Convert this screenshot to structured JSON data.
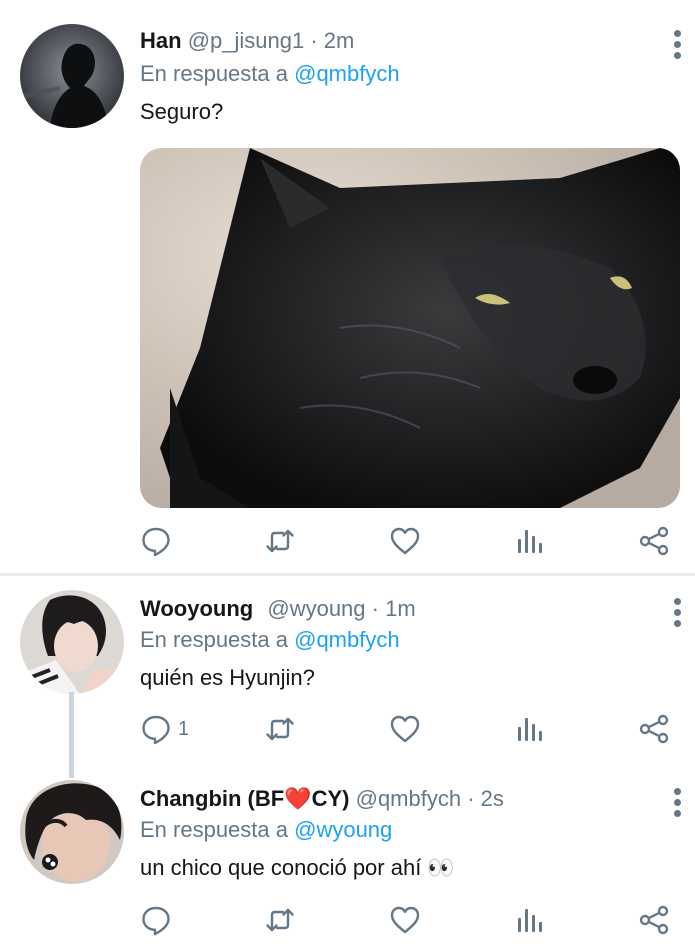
{
  "tweets": [
    {
      "name": "Han",
      "handle": "@p_jisung1",
      "time": "· 2m",
      "reply_prefix": "En respuesta a",
      "reply_to": "@qmbfych",
      "text": "Seguro?",
      "media": "black-cat-photo",
      "reply_count": "",
      "icons": [
        "reply-icon",
        "retweet-icon",
        "like-icon",
        "analytics-icon",
        "share-icon"
      ]
    },
    {
      "name": "Wooyoung",
      "handle": "@wyoung",
      "time": "· 1m",
      "reply_prefix": "En respuesta a",
      "reply_to": "@qmbfych",
      "text": "quién es Hyunjin?",
      "reply_count": "1",
      "icons": [
        "reply-icon",
        "retweet-icon",
        "like-icon",
        "analytics-icon",
        "share-icon"
      ]
    },
    {
      "name": "Changbin (BF❤️CY)",
      "handle": "@qmbfych",
      "time": "· 2s",
      "reply_prefix": "En respuesta a",
      "reply_to": "@wyoung",
      "text": "un chico que conoció por ahí 👀",
      "reply_count": "",
      "icons": [
        "reply-icon",
        "retweet-icon",
        "like-icon",
        "analytics-icon",
        "share-icon"
      ]
    }
  ],
  "colors": {
    "accent": "#1da1f2",
    "secondary_text": "#657786",
    "primary_text": "#14171a",
    "divider": "#e6ecf0"
  }
}
